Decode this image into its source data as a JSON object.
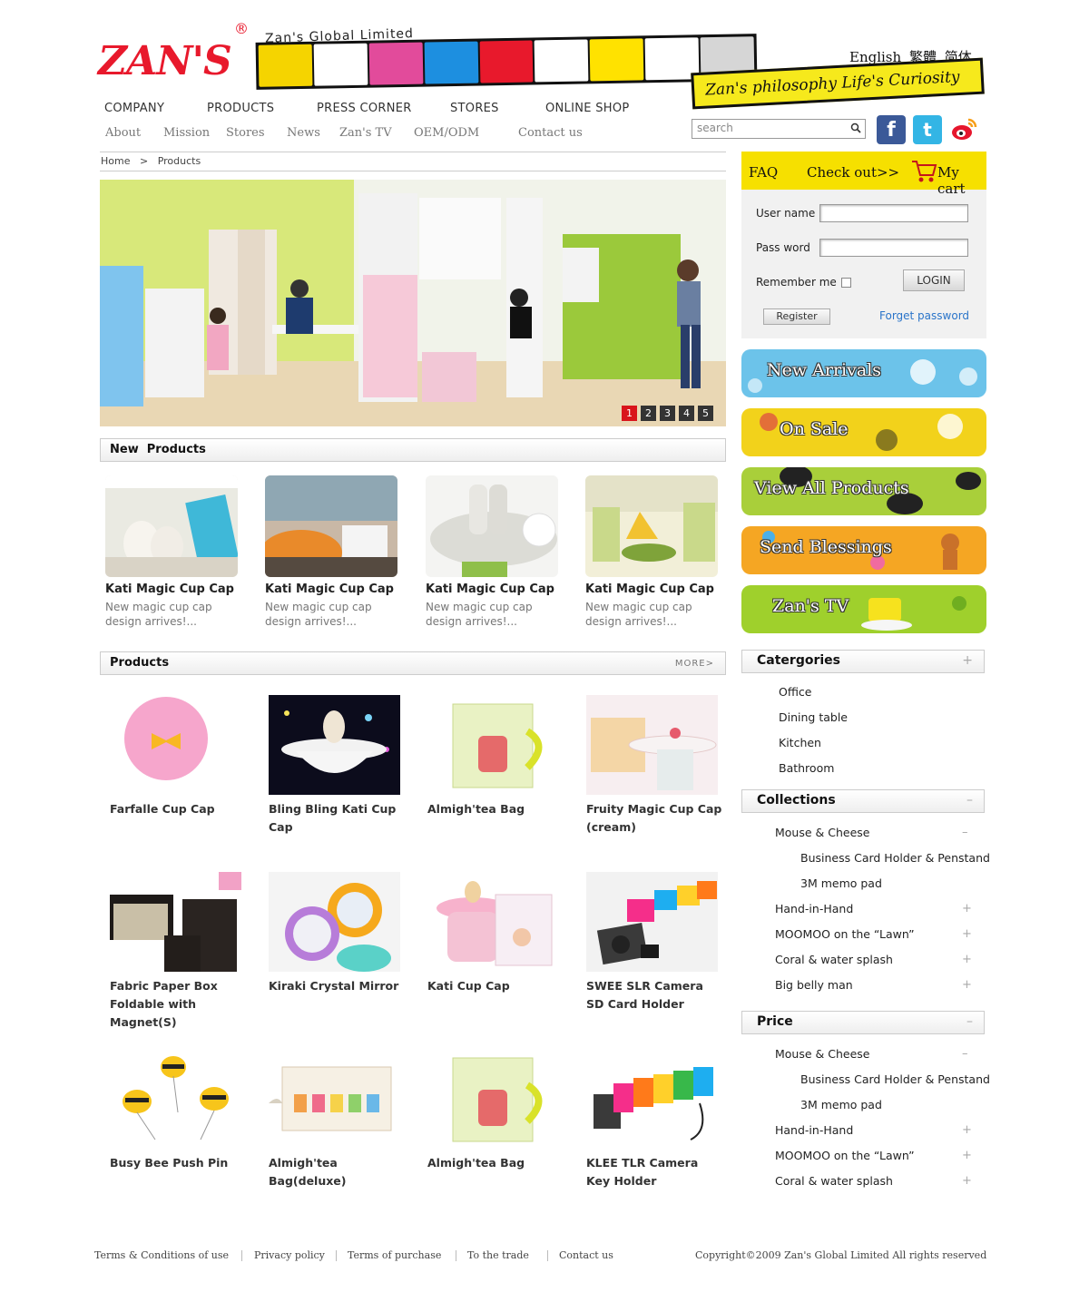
{
  "brand": {
    "logo_text": "ZAN'S",
    "registered": "®",
    "company_name": "Zan's Global Limited",
    "tagline": "Zan's philosophy Life's Curiosity",
    "languages": [
      "English",
      "繁體",
      "简体"
    ]
  },
  "nav": {
    "main": [
      "COMPANY",
      "PRODUCTS",
      "PRESS CORNER",
      "STORES",
      "ONLINE SHOP"
    ],
    "sub": [
      "About",
      "Mission",
      "Stores",
      "News",
      "Zan's TV",
      "OEM/ODM",
      "Contact us"
    ]
  },
  "search": {
    "placeholder": "search"
  },
  "social": {
    "facebook": "f",
    "twitter": "t"
  },
  "breadcrumb": {
    "home": "Home",
    "separator": ">",
    "current": "Products"
  },
  "slider": {
    "pages": [
      "1",
      "2",
      "3",
      "4",
      "5"
    ],
    "active_page": 1
  },
  "new_products": {
    "title": "New  Products",
    "items": [
      {
        "title": "Kati Magic Cup Cap",
        "desc": "New magic cup cap design arrives!..."
      },
      {
        "title": "Kati Magic Cup Cap",
        "desc": "New magic cup cap design arrives!..."
      },
      {
        "title": "Kati Magic Cup Cap",
        "desc": "New magic cup cap design arrives!..."
      },
      {
        "title": "Kati Magic Cup Cap",
        "desc": "New magic cup cap design arrives!..."
      }
    ]
  },
  "products": {
    "title": "Products",
    "more": "MORE>",
    "items": [
      "Farfalle Cup Cap",
      "Bling Bling Kati Cup Cap",
      "Almigh'tea Bag",
      "Fruity Magic Cup Cap (cream)",
      "Fabric Paper Box Foldable with Magnet(S)",
      "Kiraki Crystal Mirror",
      "Kati Cup Cap",
      "SWEE SLR Camera SD Card Holder",
      "Busy Bee Push Pin",
      "Almigh'tea Bag(deluxe)",
      "Almigh'tea Bag",
      "KLEE TLR Camera Key Holder"
    ]
  },
  "login": {
    "faq": "FAQ",
    "checkout": "Check out>>",
    "cart": "My cart",
    "username_label": "User name",
    "password_label": "Pass word",
    "remember_label": "Remember me",
    "login_button": "LOGIN",
    "register_button": "Register",
    "forget_link": "Forget password"
  },
  "promos": [
    "New Arrivals",
    "On Sale",
    "View All Products",
    "Send Blessings",
    "Zan's TV"
  ],
  "categories": {
    "title": "Catergories",
    "toggle": "+",
    "items": [
      "Office",
      "Dining table",
      "Kitchen",
      "Bathroom"
    ]
  },
  "collections": {
    "title": "Collections",
    "toggle": "–",
    "items": [
      {
        "label": "Mouse & Cheese",
        "toggle": "–"
      },
      {
        "label": "Business Card Holder & Penstand"
      },
      {
        "label": "3M memo pad"
      },
      {
        "label": "Hand-in-Hand",
        "toggle": "+"
      },
      {
        "label": "MOOMOO on the “Lawn”",
        "toggle": "+"
      },
      {
        "label": "Coral & water splash",
        "toggle": "+"
      },
      {
        "label": "Big belly man",
        "toggle": "+"
      }
    ]
  },
  "price": {
    "title": "Price",
    "toggle": "–",
    "items": [
      {
        "label": "Mouse & Cheese",
        "toggle": "–"
      },
      {
        "label": "Business Card Holder & Penstand"
      },
      {
        "label": "3M memo pad"
      },
      {
        "label": "Hand-in-Hand",
        "toggle": "+"
      },
      {
        "label": "MOOMOO on the “Lawn”",
        "toggle": "+"
      },
      {
        "label": "Coral & water splash",
        "toggle": "+"
      }
    ]
  },
  "footer": {
    "links": [
      "Terms & Conditions of use",
      "Privacy policy",
      "Terms of purchase",
      "To the trade",
      "Contact us"
    ],
    "copyright": "Copyright©2009 Zan's Global Limited All rights reserved"
  },
  "colors": {
    "brand_red": "#e8192c",
    "accent_yellow": "#f6e000",
    "link_blue": "#2a74c9",
    "pager_active": "#d9141b"
  }
}
